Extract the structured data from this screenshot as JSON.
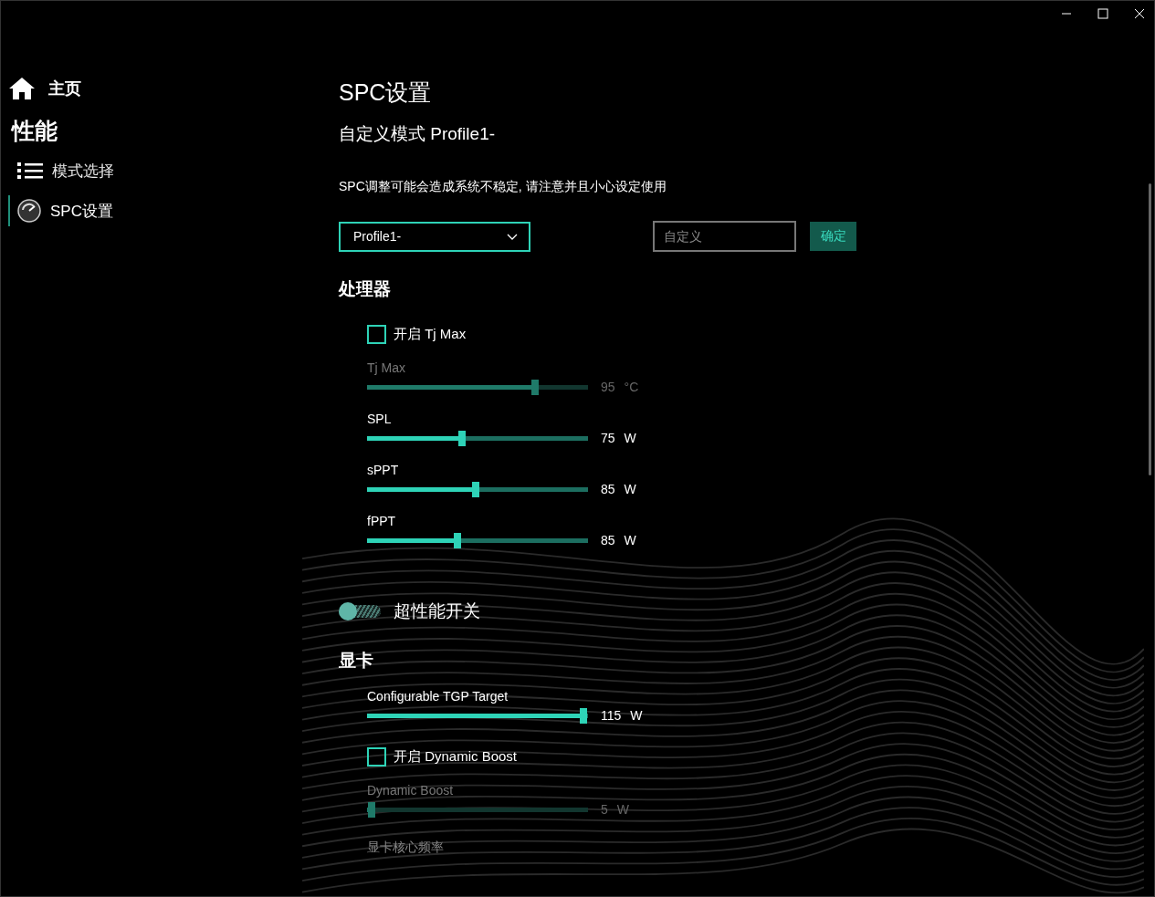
{
  "sidebar": {
    "home": "主页",
    "section": "性能",
    "items": [
      {
        "label": "模式选择",
        "selected": false
      },
      {
        "label": "SPC设置",
        "selected": true
      }
    ]
  },
  "page": {
    "title": "SPC设置",
    "subtitle": "自定义模式 Profile1-",
    "warning": "SPC调整可能会造成系统不稳定, 请注意并且小心设定使用"
  },
  "profile": {
    "dropdown": "Profile1-",
    "name_field": {
      "placeholder": "自定义"
    },
    "confirm_button": "确定"
  },
  "sections": [
    {
      "title": "处理器",
      "items": [
        {
          "kind": "checkbox",
          "label": "开启 Tj Max",
          "checked": false
        },
        {
          "kind": "slider",
          "label": "Tj Max",
          "level": 0.76,
          "value": "95",
          "unit": "°C",
          "disabled": true
        },
        {
          "kind": "slider",
          "label": "SPL",
          "level": 0.43,
          "value": "75",
          "unit": "W",
          "disabled": false
        },
        {
          "kind": "slider",
          "label": "sPPT",
          "level": 0.49,
          "value": "85",
          "unit": "W",
          "disabled": false
        },
        {
          "kind": "slider",
          "label": "fPPT",
          "level": 0.41,
          "value": "85",
          "unit": "W",
          "disabled": false
        },
        {
          "kind": "toggle",
          "label": "超性能开关",
          "on": false
        }
      ]
    },
    {
      "title": "显卡",
      "items": [
        {
          "kind": "slider",
          "label": "Configurable TGP Target",
          "level": 0.98,
          "value": "115",
          "unit": "W",
          "disabled": false
        },
        {
          "kind": "checkbox",
          "label": "开启 Dynamic Boost",
          "checked": false
        },
        {
          "kind": "slider",
          "label": "Dynamic Boost",
          "level": 0.02,
          "value": "5",
          "unit": "W",
          "disabled": true
        },
        {
          "kind": "label",
          "label": "显卡核心频率",
          "disabled": true
        }
      ]
    }
  ]
}
